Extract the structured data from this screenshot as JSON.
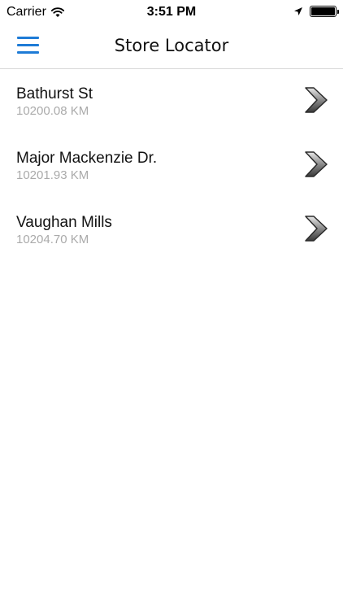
{
  "status": {
    "carrier": "Carrier",
    "time": "3:51 PM"
  },
  "header": {
    "title": "Store Locator"
  },
  "stores": [
    {
      "name": "Bathurst St",
      "distance": "10200.08 KM"
    },
    {
      "name": "Major Mackenzie Dr.",
      "distance": "10201.93 KM"
    },
    {
      "name": "Vaughan Mills",
      "distance": "10204.70 KM"
    }
  ],
  "colors": {
    "accent": "#1e7bd6",
    "distance_text": "#aaaaaa",
    "divider": "#d8d8d8"
  },
  "icons": {
    "menu": "hamburger-menu-icon",
    "row": "chevron-right-icon"
  }
}
